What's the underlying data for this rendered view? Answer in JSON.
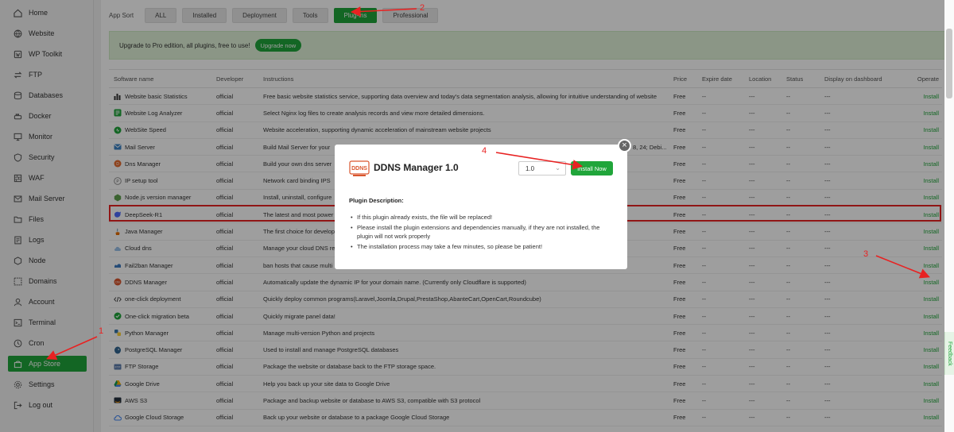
{
  "sidebar": {
    "items": [
      {
        "label": "Home",
        "icon": "home-icon",
        "active": false
      },
      {
        "label": "Website",
        "icon": "globe-icon",
        "active": false
      },
      {
        "label": "WP Toolkit",
        "icon": "wordpress-icon",
        "active": false
      },
      {
        "label": "FTP",
        "icon": "transfer-icon",
        "active": false
      },
      {
        "label": "Databases",
        "icon": "database-icon",
        "active": false
      },
      {
        "label": "Docker",
        "icon": "docker-icon",
        "active": false
      },
      {
        "label": "Monitor",
        "icon": "monitor-icon",
        "active": false
      },
      {
        "label": "Security",
        "icon": "shield-icon",
        "active": false
      },
      {
        "label": "WAF",
        "icon": "firewall-icon",
        "active": false
      },
      {
        "label": "Mail Server",
        "icon": "mail-icon",
        "active": false
      },
      {
        "label": "Files",
        "icon": "folder-icon",
        "active": false
      },
      {
        "label": "Logs",
        "icon": "logs-icon",
        "active": false
      },
      {
        "label": "Node",
        "icon": "node-icon",
        "active": false
      },
      {
        "label": "Domains",
        "icon": "domains-icon",
        "active": false
      },
      {
        "label": "Account",
        "icon": "user-icon",
        "active": false
      },
      {
        "label": "Terminal",
        "icon": "terminal-icon",
        "active": false
      },
      {
        "label": "Cron",
        "icon": "clock-icon",
        "active": false
      },
      {
        "label": "App Store",
        "icon": "store-icon",
        "active": true
      },
      {
        "label": "Settings",
        "icon": "gear-icon",
        "active": false
      },
      {
        "label": "Log out",
        "icon": "logout-icon",
        "active": false
      }
    ]
  },
  "sort": {
    "label": "App Sort",
    "buttons": [
      {
        "label": "ALL",
        "active": false
      },
      {
        "label": "Installed",
        "active": false
      },
      {
        "label": "Deployment",
        "active": false
      },
      {
        "label": "Tools",
        "active": false
      },
      {
        "label": "Plug-ins",
        "active": true
      },
      {
        "label": "Professional",
        "active": false
      }
    ]
  },
  "banner": {
    "text": "Upgrade to Pro edition, all plugins, free to use!",
    "button": "Upgrade now"
  },
  "table": {
    "headers": {
      "name": "Software name",
      "developer": "Developer",
      "instructions": "Instructions",
      "price": "Price",
      "expire": "Expire date",
      "location": "Location",
      "status": "Status",
      "display": "Display on dashboard",
      "operate": "Operate"
    },
    "rows": [
      {
        "name": "Website basic Statistics",
        "icon": "stats-icon",
        "developer": "official",
        "instructions": "Free basic website statistics service, supporting data overview and today's data segmentation analysis, allowing for intuitive understanding of website",
        "price": "Free",
        "expire": "--",
        "location": "---",
        "status": "--",
        "display": "---",
        "operate": "Install"
      },
      {
        "name": "Website Log Analyzer",
        "icon": "log-analyzer-icon",
        "developer": "official",
        "instructions": "Select Nginx log files to create analysis records and view more detailed dimensions.",
        "price": "Free",
        "expire": "--",
        "location": "---",
        "status": "--",
        "display": "---",
        "operate": "Install"
      },
      {
        "name": "WebSite Speed",
        "icon": "speed-icon",
        "developer": "official",
        "instructions": "Website acceleration, supporting dynamic acceleration of mainstream website projects",
        "price": "Free",
        "expire": "--",
        "location": "---",
        "status": "--",
        "display": "---",
        "operate": "Install"
      },
      {
        "name": "Mail Server",
        "icon": "mail-server-icon",
        "developer": "official",
        "instructions": "Build Mail Server for your",
        "instructions_tail": "8, 24; Debi...",
        "price": "Free",
        "expire": "--",
        "location": "---",
        "status": "--",
        "display": "---",
        "operate": "Install"
      },
      {
        "name": "Dns Manager",
        "icon": "dns-icon",
        "developer": "official",
        "instructions": "Build your own dns server",
        "price": "Free",
        "expire": "--",
        "location": "---",
        "status": "--",
        "display": "---",
        "operate": "Install"
      },
      {
        "name": "IP setup tool",
        "icon": "ip-icon",
        "developer": "official",
        "instructions": "Network card binding IPS",
        "price": "Free",
        "expire": "--",
        "location": "---",
        "status": "--",
        "display": "---",
        "operate": "Install"
      },
      {
        "name": "Node.js version manager",
        "icon": "nodejs-icon",
        "developer": "official",
        "instructions": "Install, uninstall, configure",
        "price": "Free",
        "expire": "--",
        "location": "---",
        "status": "--",
        "display": "---",
        "operate": "Install"
      },
      {
        "name": "DeepSeek-R1",
        "icon": "deepseek-icon",
        "developer": "official",
        "instructions": "The latest and most power",
        "price": "Free",
        "expire": "--",
        "location": "---",
        "status": "--",
        "display": "---",
        "operate": "Install"
      },
      {
        "name": "Java Manager",
        "icon": "java-icon",
        "developer": "official",
        "instructions": "The first choice for develop",
        "price": "Free",
        "expire": "--",
        "location": "---",
        "status": "--",
        "display": "---",
        "operate": "Install"
      },
      {
        "name": "Cloud dns",
        "icon": "cloud-dns-icon",
        "developer": "official",
        "instructions": "Manage your cloud DNS re",
        "price": "Free",
        "expire": "--",
        "location": "---",
        "status": "--",
        "display": "---",
        "operate": "Install"
      },
      {
        "name": "Fail2ban Manager",
        "icon": "fail2ban-icon",
        "developer": "official",
        "instructions": "ban hosts that cause multi",
        "price": "Free",
        "expire": "--",
        "location": "---",
        "status": "--",
        "display": "---",
        "operate": "Install"
      },
      {
        "name": "DDNS Manager",
        "icon": "ddns-icon",
        "developer": "official",
        "instructions": "Automatically update the dynamic IP for your domain name. (Currently only Cloudflare is supported)",
        "price": "Free",
        "expire": "--",
        "location": "---",
        "status": "--",
        "display": "---",
        "operate": "Install"
      },
      {
        "name": "one-click deployment",
        "icon": "code-icon",
        "developer": "official",
        "instructions": "Quickly deploy common programs(Laravel,Joomla,Drupal,PrestaShop,AbanteCart,OpenCart,Roundcube)",
        "price": "Free",
        "expire": "--",
        "location": "---",
        "status": "--",
        "display": "---",
        "operate": "Install"
      },
      {
        "name": "One-click migration beta",
        "icon": "migration-icon",
        "developer": "official",
        "instructions": "Quickly migrate panel data!",
        "price": "Free",
        "expire": "--",
        "location": "---",
        "status": "--",
        "display": "---",
        "operate": "Install"
      },
      {
        "name": "Python Manager",
        "icon": "python-icon",
        "developer": "official",
        "instructions": "Manage multi-version Python and projects",
        "price": "Free",
        "expire": "--",
        "location": "---",
        "status": "--",
        "display": "---",
        "operate": "Install"
      },
      {
        "name": "PostgreSQL Manager",
        "icon": "postgresql-icon",
        "developer": "official",
        "instructions": "Used to install and manage PostgreSQL databases",
        "price": "Free",
        "expire": "--",
        "location": "---",
        "status": "--",
        "display": "---",
        "operate": "Install"
      },
      {
        "name": "FTP Storage",
        "icon": "ftp-storage-icon",
        "developer": "official",
        "instructions": "Package the website or database back to the FTP storage space.",
        "price": "Free",
        "expire": "--",
        "location": "---",
        "status": "--",
        "display": "---",
        "operate": "Install"
      },
      {
        "name": "Google Drive",
        "icon": "google-drive-icon",
        "developer": "official",
        "instructions": "Help you back up your site data to Google Drive",
        "price": "Free",
        "expire": "--",
        "location": "---",
        "status": "--",
        "display": "---",
        "operate": "Install"
      },
      {
        "name": "AWS S3",
        "icon": "aws-icon",
        "developer": "official",
        "instructions": "Package and backup website or database to AWS S3, compatible with S3 protocol",
        "price": "Free",
        "expire": "--",
        "location": "---",
        "status": "--",
        "display": "---",
        "operate": "Install"
      },
      {
        "name": "Google Cloud Storage",
        "icon": "google-cloud-icon",
        "developer": "official",
        "instructions": "Back up your website or database to a package Google Cloud Storage",
        "price": "Free",
        "expire": "--",
        "location": "---",
        "status": "--",
        "display": "---",
        "operate": "Install"
      }
    ]
  },
  "side_tab": {
    "label": "Feedback"
  },
  "modal": {
    "title": "DDNS Manager 1.0",
    "logo_text": "DDNS",
    "version": "1.0",
    "install_button": "Install Now",
    "desc_title": "Plugin Description:",
    "desc_items": [
      "If this plugin already exists, the file will be replaced!",
      "Please install the plugin extensions and dependencies manually, if they are not installed, the plugin will not work properly",
      "The installation process may take a few minutes, so please be patient!"
    ]
  },
  "annotations": {
    "steps": [
      "1",
      "2",
      "3",
      "4"
    ],
    "color": "#e82222"
  },
  "colors": {
    "accent": "#20a53a",
    "highlight": "#e82222",
    "banner_bg": "#e1f3d9"
  }
}
